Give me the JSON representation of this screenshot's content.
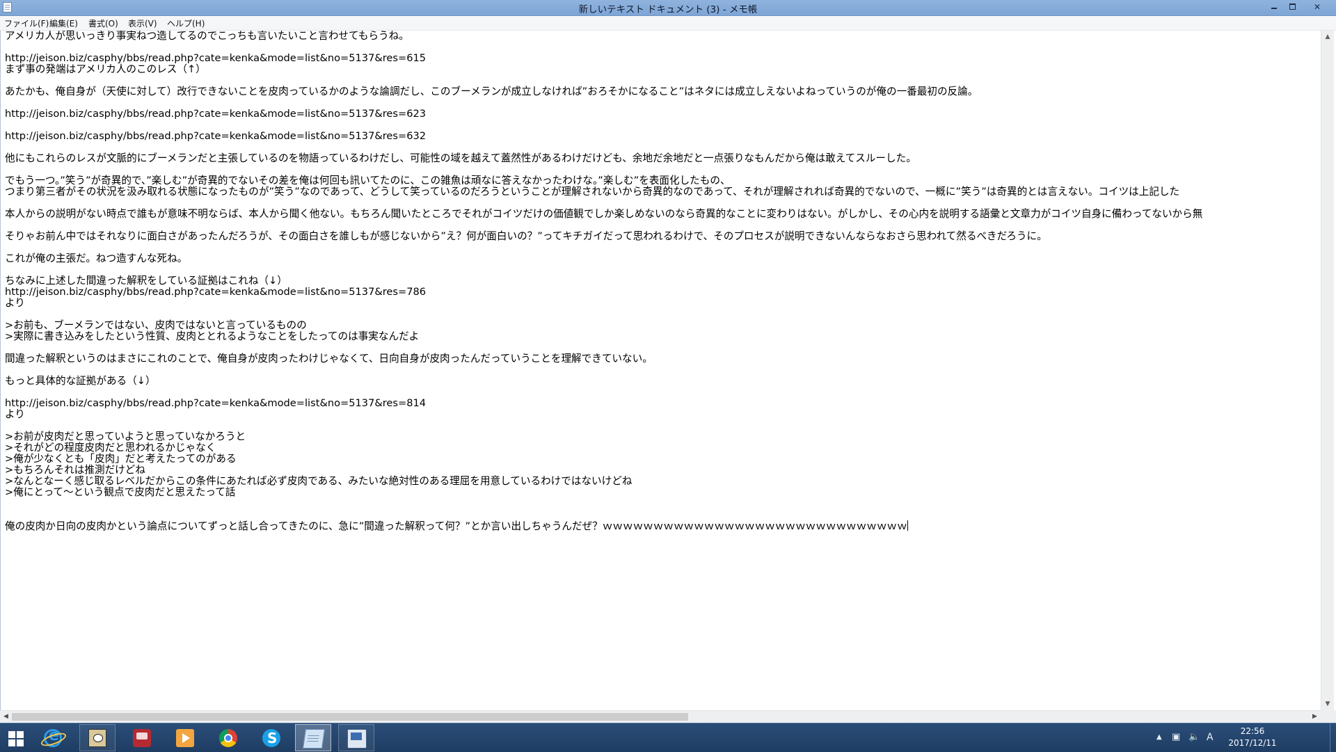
{
  "window": {
    "title": "新しいテキスト ドキュメント (3) - メモ帳"
  },
  "menu": {
    "file": "ファイル(F)",
    "edit": "編集(E)",
    "format": "書式(O)",
    "view": "表示(V)",
    "help": "ヘルプ(H)"
  },
  "editor": {
    "lines": [
      "アメリカ人が思いっきり事実ねつ造してるのでこっちも言いたいこと言わせてもらうね。",
      "",
      "http://jeison.biz/casphy/bbs/read.php?cate=kenka&mode=list&no=5137&res=615",
      "まず事の発端はアメリカ人のこのレス（↑）",
      "",
      "あたかも、俺自身が（天使に対して）改行できないことを皮肉っているかのような論調だし、このブーメランが成立しなければ”おろそかになること”はネタには成立しえないよねっていうのが俺の一番最初の反論。",
      "",
      "http://jeison.biz/casphy/bbs/read.php?cate=kenka&mode=list&no=5137&res=623",
      "",
      "http://jeison.biz/casphy/bbs/read.php?cate=kenka&mode=list&no=5137&res=632",
      "",
      "他にもこれらのレスが文脈的にブーメランだと主張しているのを物語っているわけだし、可能性の域を越えて蓋然性があるわけだけども、余地だ余地だと一点張りなもんだから俺は敢えてスルーした。",
      "",
      "でもう一つ。”笑う”が奇異的で、”楽しむ”が奇異的でないその差を俺は何回も訊いてたのに、この雑魚は頑なに答えなかったわけな。”楽しむ”を表面化したもの、",
      "つまり第三者がその状況を汲み取れる状態になったものが”笑う”なのであって、どうして笑っているのだろうということが理解されないから奇異的なのであって、それが理解されれば奇異的でないので、一概に”笑う”は奇異的とは言えない。コイツは上記した",
      "",
      "本人からの説明がない時点で誰もが意味不明ならば、本人から聞く他ない。もちろん聞いたところでそれがコイツだけの価値観でしか楽しめないのなら奇異的なことに変わりはない。がしかし、その心内を説明する語彙と文章力がコイツ自身に備わってないから無",
      "",
      "そりゃお前ん中ではそれなりに面白さがあったんだろうが、その面白さを誰しもが感じないから”え？何が面白いの？”ってキチガイだって思われるわけで、そのプロセスが説明できないんならなおさら思われて然るべきだろうに。",
      "",
      "これが俺の主張だ。ねつ造すんな死ね。",
      "",
      "ちなみに上述した間違った解釈をしている証拠はこれね（↓）",
      "http://jeison.biz/casphy/bbs/read.php?cate=kenka&mode=list&no=5137&res=786",
      "より",
      "",
      ">お前も、ブーメランではない、皮肉ではないと言っているものの",
      ">実際に書き込みをしたという性質、皮肉ととれるようなことをしたってのは事実なんだよ",
      "",
      "間違った解釈というのはまさにこれのことで、俺自身が皮肉ったわけじゃなくて、日向自身が皮肉ったんだっていうことを理解できていない。",
      "",
      "もっと具体的な証拠がある（↓）",
      "",
      "http://jeison.biz/casphy/bbs/read.php?cate=kenka&mode=list&no=5137&res=814",
      "より",
      "",
      ">お前が皮肉だと思っていようと思っていなかろうと",
      ">それがどの程度皮肉だと思われるかじゃなく",
      ">俺が少なくとも「皮肉」だと考えたってのがある",
      ">もちろんそれは推測だけどね",
      ">なんとなーく感じ取るレベルだからこの条件にあたれば必ず皮肉である、みたいな絶対性のある理屈を用意しているわけではないけどね",
      ">俺にとって～という観点で皮肉だと思えたって話",
      "",
      "",
      "俺の皮肉か日向の皮肉かという論点についてずっと話し合ってきたのに、急に”間違った解釈って何？”とか言い出しちゃうんだぜ？ｗｗｗｗｗｗｗｗｗｗｗｗｗｗｗｗｗｗｗｗｗｗｗｗｗｗｗｗｗｗ"
    ]
  },
  "taskbar": {
    "items": [
      "start-button",
      "ie-icon",
      "game-icon",
      "red-app-icon",
      "media-icon",
      "chrome-icon",
      "skype-icon",
      "notepad-icon",
      "rdp-icon"
    ],
    "active": "notepad-icon"
  },
  "tray": {
    "ime": "A",
    "time": "22:56",
    "date": "2017/12/11"
  },
  "colors": {
    "titlebar": "#7ea5d6",
    "taskbar": "#1f3d63",
    "scrollbar_thumb": "#cdcdcd"
  }
}
